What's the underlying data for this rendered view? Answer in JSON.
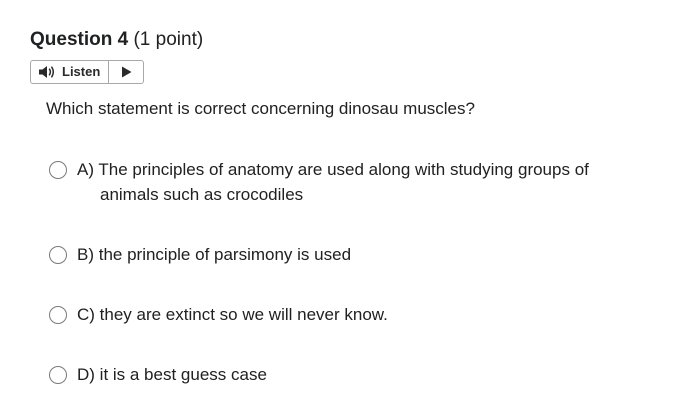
{
  "question": {
    "title": "Question 4",
    "points": "(1 point)",
    "text": "Which statement is correct concerning dinosau muscles?"
  },
  "toolbar": {
    "listen_label": "Listen"
  },
  "options": [
    {
      "line1": "A) The principles of anatomy are used along with studying groups of",
      "line2": "animals such as crocodiles"
    },
    {
      "label": "B) the principle of parsimony is used"
    },
    {
      "label": "C) they are extinct so we will never know."
    },
    {
      "label": "D) it is a best guess case"
    }
  ],
  "colors": {
    "text": "#202122",
    "border": "#a8a8a8",
    "radio_border": "#7a7a7a",
    "icon": "#2a2a2a"
  },
  "icons": {
    "listen": "speaker-icon",
    "play": "play-icon"
  }
}
